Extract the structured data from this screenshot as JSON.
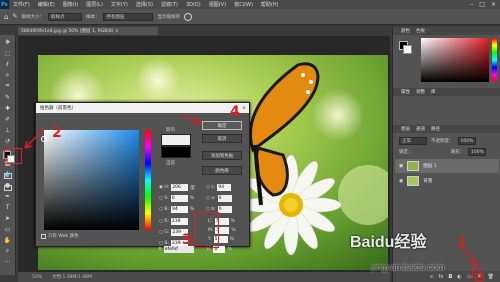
{
  "menu": {
    "app_icon": "Ps",
    "items": [
      "文件(F)",
      "编辑(E)",
      "图像(I)",
      "图层(L)",
      "文字(Y)",
      "选择(S)",
      "滤镜(T)",
      "3D(D)",
      "视图(V)",
      "窗口(W)",
      "帮助(H)"
    ],
    "window_controls": [
      "–",
      "□",
      "×"
    ]
  },
  "options_bar": {
    "sample_size_label": "取样大小：",
    "sample_size_value": "取样点",
    "sample_label": "样本：",
    "sample_value": "所有图层",
    "show_ring": "显示取样环"
  },
  "document": {
    "tab_label": "586d0fdfe1e4.jpg @ 50% (图层 1, RGB/8) ×",
    "status_zoom": "50%",
    "status_doc": "文档:1.98M/1.98M"
  },
  "panels": {
    "color_tabs": [
      "颜色",
      "色板"
    ],
    "adjust_tabs": [
      "属性",
      "调整",
      "库"
    ],
    "layer_tabs": [
      "图层",
      "通道",
      "路径"
    ],
    "blend_mode": "正常",
    "opacity_label": "不透明度：",
    "opacity_value": "100%",
    "fill_label": "填充：",
    "fill_value": "100%",
    "lock_label": "锁定：",
    "layers": [
      {
        "name": "图层 1"
      },
      {
        "name": "背景"
      }
    ]
  },
  "color_picker": {
    "title": "拾色器（前景色）",
    "new_label": "新的",
    "current_label": "当前",
    "buttons": {
      "ok": "确定",
      "cancel": "取消",
      "add_swatch": "添加到色板",
      "libraries": "颜色库"
    },
    "web_only_label": "只有 Web 颜色",
    "fields": {
      "H": "206",
      "H_unit": "度",
      "S": "0",
      "S_unit": "%",
      "B": "94",
      "B_unit": "%",
      "R": "239",
      "G": "239",
      "Bv": "239",
      "L": "94",
      "a": "0",
      "b": "0",
      "C": "7",
      "C_unit": "%",
      "M": "5",
      "M_unit": "%",
      "Y": "5",
      "Y_unit": "%",
      "K": "0",
      "K_unit": "%",
      "hex": "efefef"
    }
  },
  "annotations": {
    "one": "1",
    "two": "2",
    "three": "3",
    "four": "4"
  },
  "watermark": {
    "logo": "Baidu经验",
    "url": "jingyan.baidu.com"
  },
  "colors": {
    "annotation_red": "#e01c1c",
    "chrome_dark": "#535353",
    "accent_blue": "#31a8ff"
  }
}
